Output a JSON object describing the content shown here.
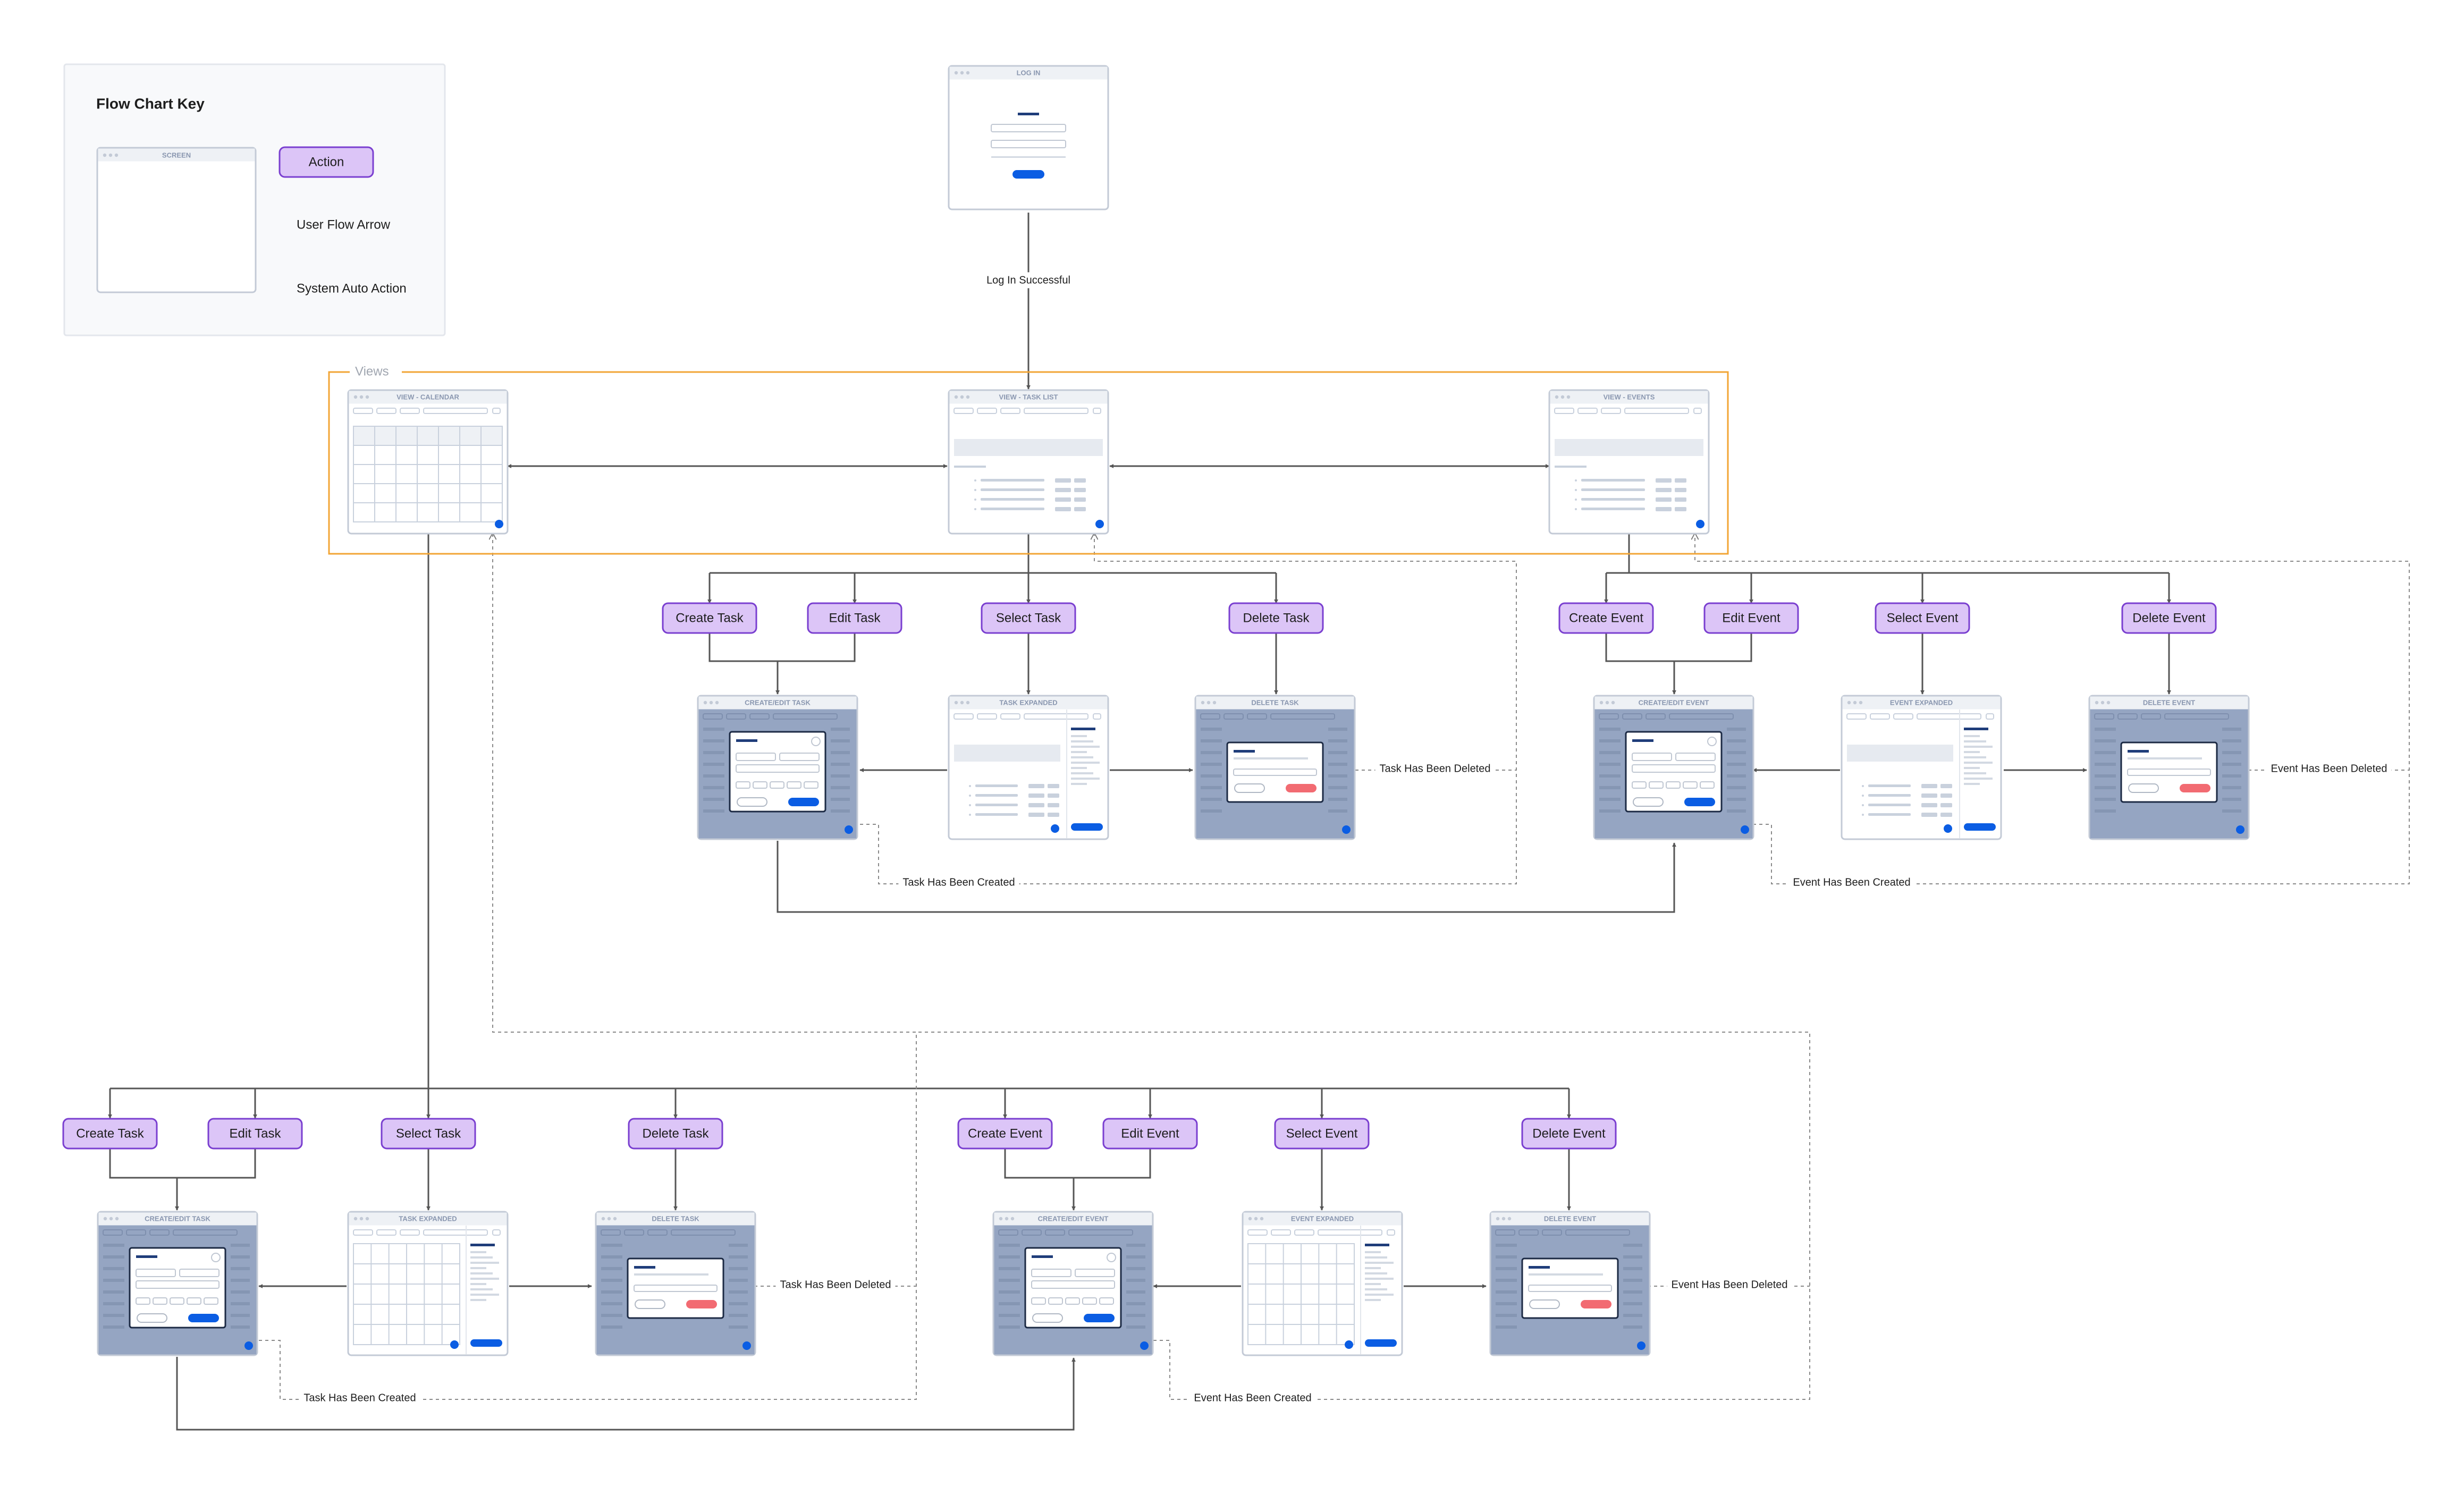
{
  "key": {
    "title": "Flow Chart Key",
    "screen_label": "SCREEN",
    "action_label": "Action",
    "user_flow_label": "User Flow Arrow",
    "system_auto_label": "System Auto Action"
  },
  "views_group_label": "Views",
  "screens": {
    "login": "LOG IN",
    "view_calendar": "VIEW - CALENDAR",
    "view_task_list": "VIEW - TASK LIST",
    "view_events": "VIEW - EVENTS",
    "create_edit_task": "CREATE/EDIT TASK",
    "task_expanded": "TASK EXPANDED",
    "delete_task": "DELETE TASK",
    "create_edit_event": "CREATE/EDIT EVENT",
    "event_expanded": "EVENT EXPANDED",
    "delete_event": "DELETE EVENT"
  },
  "actions": {
    "create_task": "Create Task",
    "edit_task": "Edit Task",
    "select_task": "Select Task",
    "delete_task": "Delete Task",
    "create_event": "Create Event",
    "edit_event": "Edit Event",
    "select_event": "Select Event",
    "delete_event": "Delete Event"
  },
  "edge_labels": {
    "login_success": "Log In Successful",
    "task_deleted": "Task Has Been Deleted",
    "task_created": "Task Has Been Created",
    "event_deleted": "Event Has Been Deleted",
    "event_created": "Event Has Been Created"
  },
  "colors": {
    "action_fill": "#dcc5f7",
    "action_border": "#7a3fd0",
    "views_border": "#f2a535",
    "screen_border": "#c3cad6",
    "modal_backdrop": "#95a5c2",
    "primary_button": "#0b5de3",
    "danger_button": "#f26b72",
    "arrow": "#555555"
  }
}
